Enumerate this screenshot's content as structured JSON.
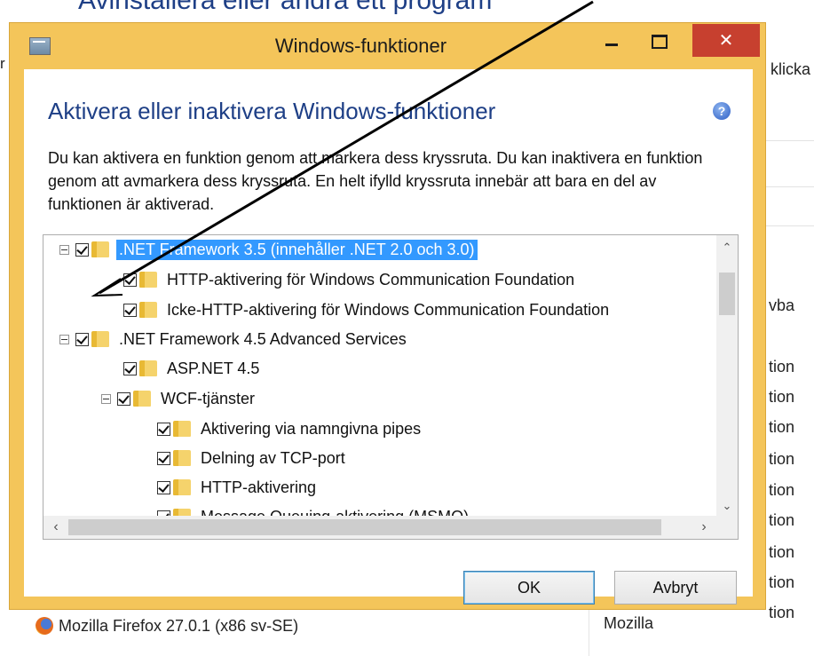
{
  "background": {
    "title": "Avinstallera eller ändra ett program",
    "left_fragment": "r",
    "right_fragment": "klicka",
    "vba_fragment": "vba",
    "tion_fragments": [
      "tion",
      "tion",
      "tion",
      "tion",
      "tion",
      "tion",
      "tion",
      "tion",
      "tion"
    ],
    "program_row": {
      "name": "Mozilla Firefox 27.0.1 (x86 sv-SE)",
      "publisher": "Mozilla"
    }
  },
  "dialog": {
    "title": "Windows-funktioner",
    "close_glyph": "✕",
    "heading": "Aktivera eller inaktivera Windows-funktioner",
    "help_glyph": "?",
    "description": "Du kan aktivera en funktion genom att markera dess kryssruta. Du kan inaktivera en funktion genom att avmarkera dess kryssruta. En helt ifylld kryssruta innebär att bara en del av funktionen är aktiverad.",
    "features": [
      {
        "label": ".NET Framework 3.5 (innehåller .NET 2.0 och 3.0)",
        "level": 0,
        "expander": true,
        "checked": true,
        "selected": true
      },
      {
        "label": "HTTP-aktivering för Windows Communication Foundation",
        "level": 1,
        "expander": false,
        "checked": true,
        "selected": false
      },
      {
        "label": "Icke-HTTP-aktivering för Windows Communication Foundation",
        "level": 1,
        "expander": false,
        "checked": true,
        "selected": false
      },
      {
        "label": ".NET Framework 4.5 Advanced Services",
        "level": 0,
        "expander": true,
        "checked": true,
        "selected": false
      },
      {
        "label": "ASP.NET 4.5",
        "level": 1,
        "expander": false,
        "checked": true,
        "selected": false
      },
      {
        "label": "WCF-tjänster",
        "level": 1,
        "expander": true,
        "checked": true,
        "selected": false
      },
      {
        "label": "Aktivering via namngivna pipes",
        "level": 2,
        "expander": false,
        "checked": true,
        "selected": false
      },
      {
        "label": "Delning av TCP-port",
        "level": 2,
        "expander": false,
        "checked": true,
        "selected": false
      },
      {
        "label": "HTTP-aktivering",
        "level": 2,
        "expander": false,
        "checked": true,
        "selected": false
      },
      {
        "label": "Message Queuing-aktivering (MSMQ)",
        "level": 2,
        "expander": false,
        "checked": true,
        "selected": false
      }
    ],
    "ok_label": "OK",
    "cancel_label": "Avbryt"
  },
  "colors": {
    "accent": "#1e3f86",
    "selection": "#3399ff",
    "frame": "#f4c55a",
    "close": "#c7402f"
  }
}
